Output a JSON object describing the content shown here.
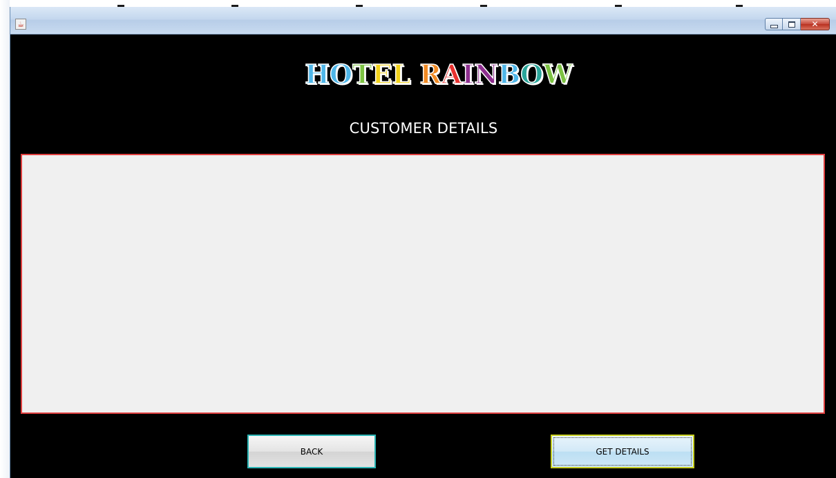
{
  "window": {
    "icon": "java-coffee-icon",
    "controls": {
      "minimize_icon": "minimize-icon",
      "maximize_icon": "maximize-icon",
      "close_icon": "close-icon",
      "close_glyph": "✕"
    }
  },
  "logo": {
    "letters": [
      {
        "ch": "H",
        "color": "#4fb6e8"
      },
      {
        "ch": "O",
        "color": "#4fb6e8"
      },
      {
        "ch": "T",
        "color": "#7cc242"
      },
      {
        "ch": "E",
        "color": "#f2d21b"
      },
      {
        "ch": "L",
        "color": "#f2d21b"
      },
      {
        "ch": " ",
        "color": "#000000"
      },
      {
        "ch": "R",
        "color": "#f08a24"
      },
      {
        "ch": "A",
        "color": "#e8312f"
      },
      {
        "ch": "I",
        "color": "#8e2f8f"
      },
      {
        "ch": "N",
        "color": "#8e2f8f"
      },
      {
        "ch": "B",
        "color": "#4fb6e8"
      },
      {
        "ch": "O",
        "color": "#2aa59a"
      },
      {
        "ch": "W",
        "color": "#7cc242"
      }
    ]
  },
  "page": {
    "title": "CUSTOMER DETAILS"
  },
  "details_area": {
    "content": ""
  },
  "buttons": {
    "back_label": "BACK",
    "get_details_label": "GET DETAILS"
  },
  "colors": {
    "background": "#000000",
    "details_border": "#e04040",
    "details_fill": "#f0f0f0",
    "back_border": "#2ab5b5",
    "get_details_border": "#c8cf1f"
  }
}
